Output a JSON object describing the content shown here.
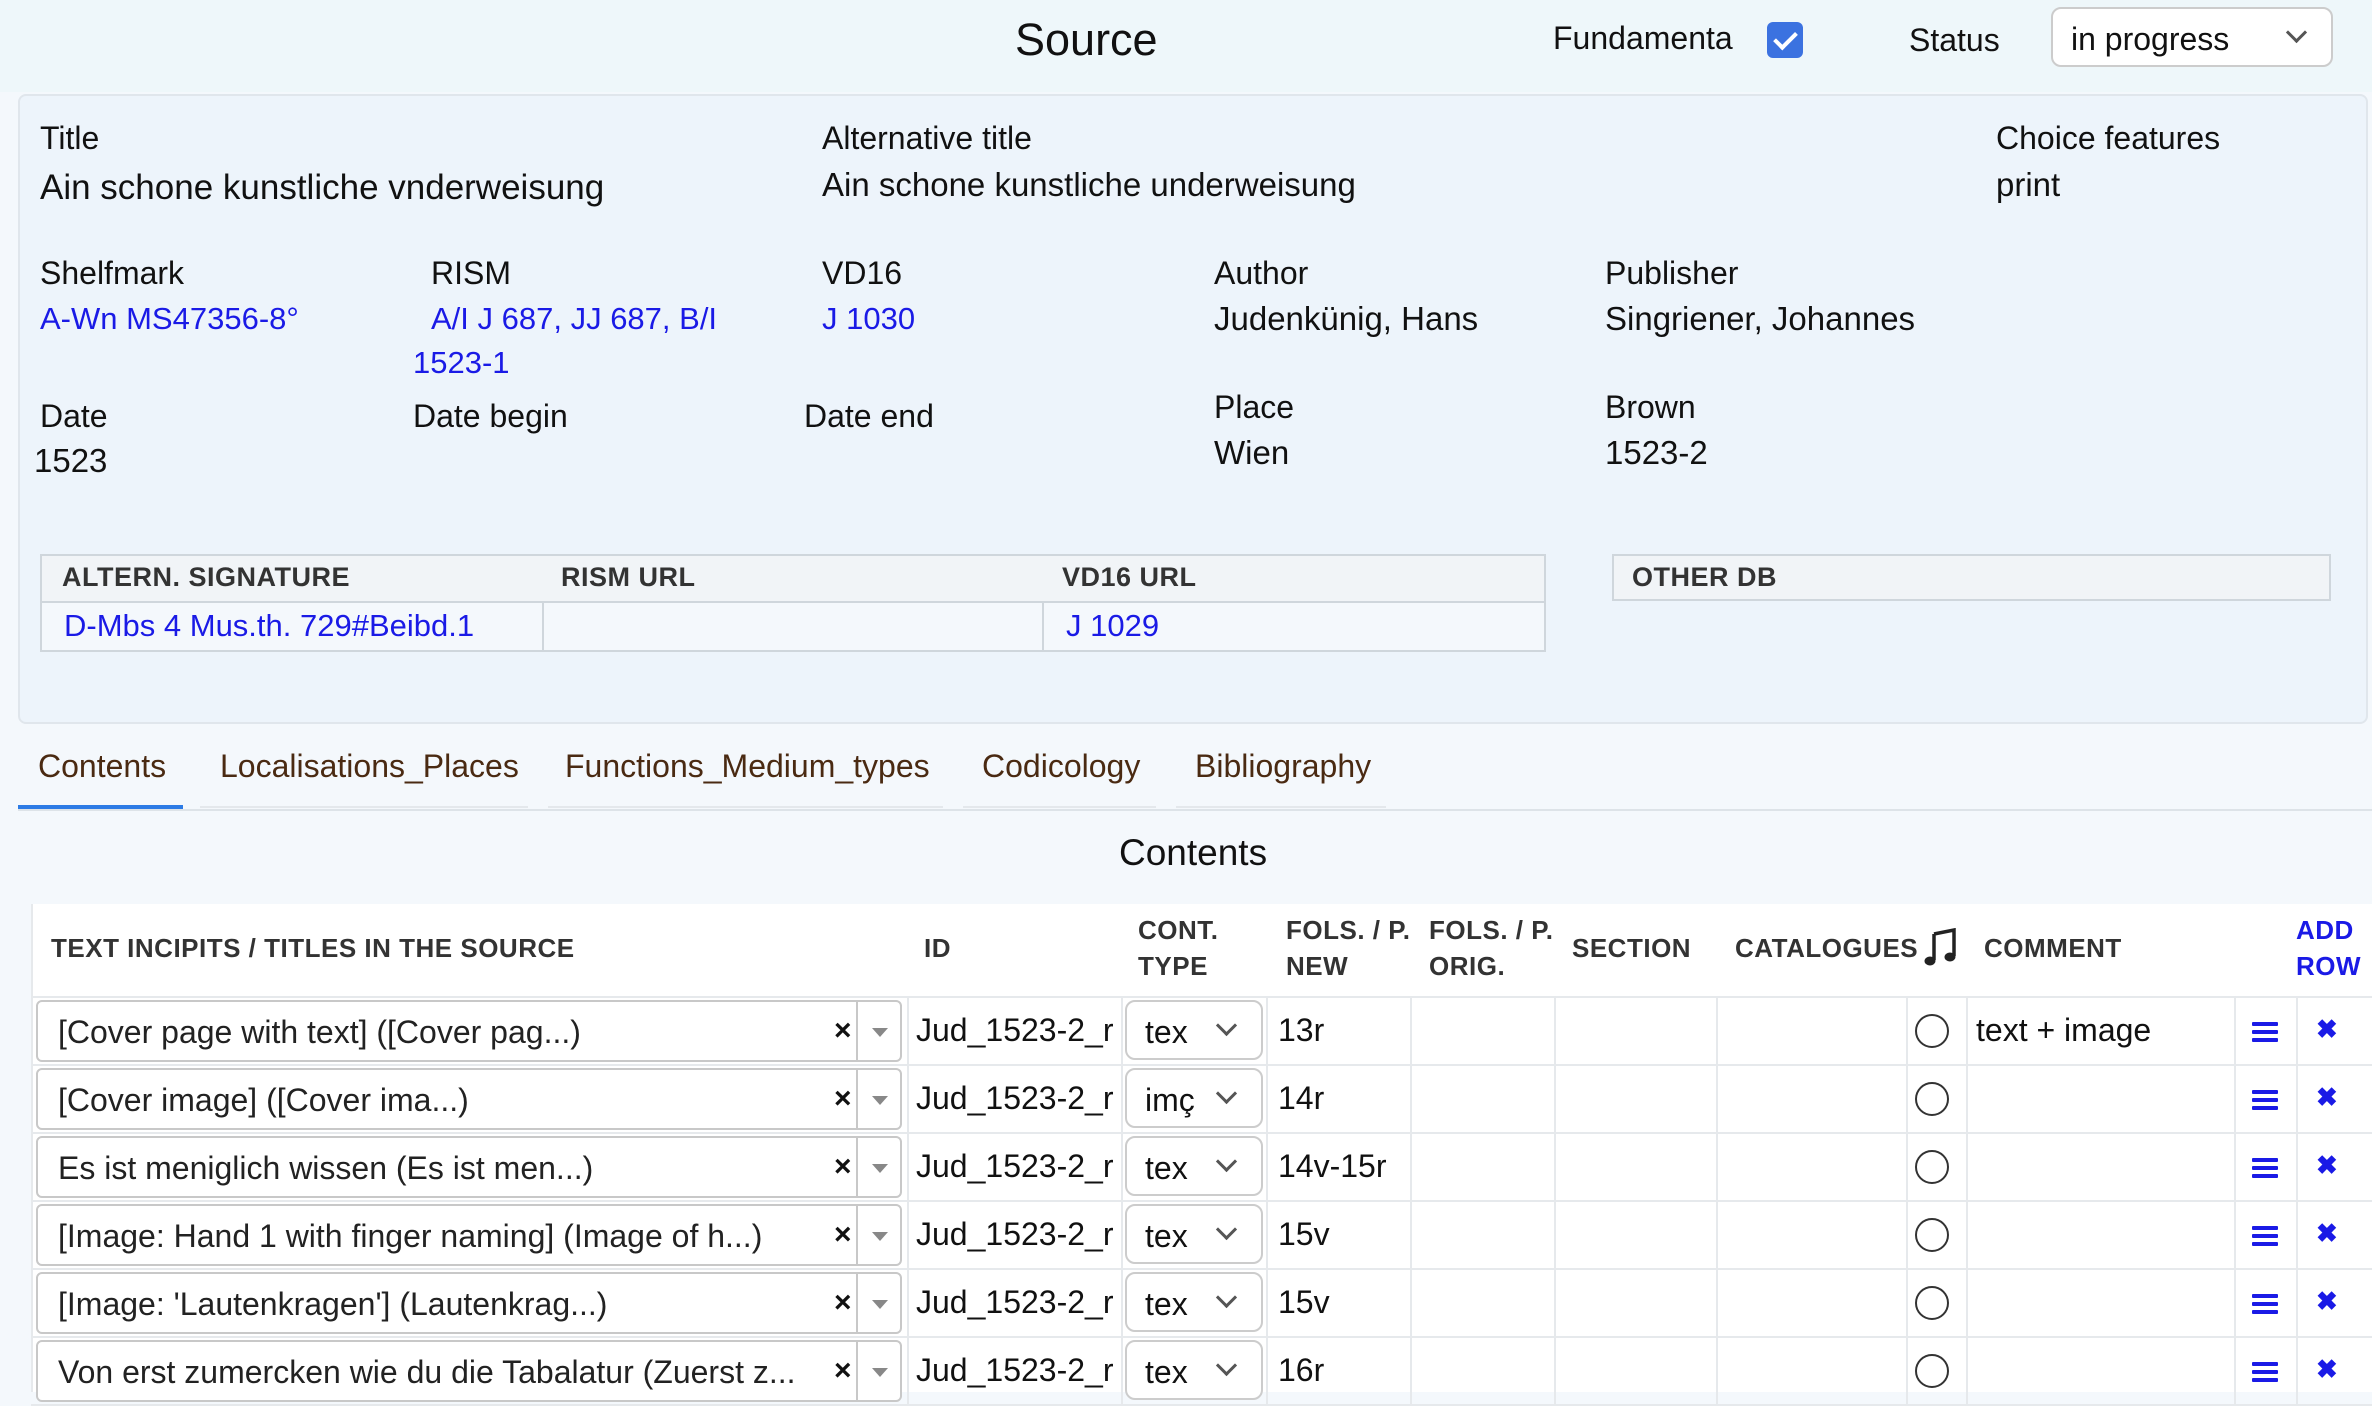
{
  "header": {
    "title": "Source",
    "fundamenta_label": "Fundamenta",
    "fundamenta_checked": true,
    "status_label": "Status",
    "status_value": "in progress"
  },
  "info": {
    "title_label": "Title",
    "title_value": "Ain schone kunstliche vnderweisung",
    "alt_title_label": "Alternative title",
    "alt_title_value": "Ain schone kunstliche underweisung",
    "choice_label": "Choice features",
    "choice_value": "print",
    "shelfmark_label": "Shelfmark",
    "shelfmark_value": "A-Wn MS47356-8°",
    "rism_label": "RISM",
    "rism_value_1": "A/I J 687, JJ 687, B/I",
    "rism_value_2": "1523-1",
    "vd16_label": "VD16",
    "vd16_value": "J 1030",
    "author_label": "Author",
    "author_value": "Judenkünig, Hans",
    "publisher_label": "Publisher",
    "publisher_value": "Singriener, Johannes",
    "date_label": "Date",
    "date_value": "1523",
    "date_begin_label": "Date begin",
    "date_end_label": "Date end",
    "place_label": "Place",
    "place_value": "Wien",
    "brown_label": "Brown",
    "brown_value": "1523-2"
  },
  "altern_table": {
    "headers": [
      "ALTERN. SIGNATURE",
      "RISM URL",
      "VD16 URL"
    ],
    "row": [
      "D-Mbs 4 Mus.th. 729#Beibd.1",
      "",
      "J 1029"
    ]
  },
  "other_db": {
    "header": "OTHER DB"
  },
  "tabs": [
    "Contents",
    "Localisations_Places",
    "Functions_Medium_types",
    "Codicology",
    "Bibliography"
  ],
  "contents": {
    "title": "Contents",
    "headers": {
      "incipit": "TEXT INCIPITS / TITLES IN THE SOURCE",
      "id": "ID",
      "cont_type_1": "CONT.",
      "cont_type_2": "TYPE",
      "fols_new_1": "FOLS. / P.",
      "fols_new_2": "NEW",
      "fols_orig_1": "FOLS. / P.",
      "fols_orig_2": "ORIG.",
      "section": "SECTION",
      "catalogues": "CATALOGUES",
      "music_icon": "music-note-icon",
      "comment": "COMMENT",
      "add_row_1": "ADD",
      "add_row_2": "ROW"
    },
    "rows": [
      {
        "incipit": "[Cover page with text] ([Cover pag...)",
        "id": "Jud_1523-2_r",
        "type": "tex",
        "fols": "13r",
        "comment": "text + image"
      },
      {
        "incipit": "[Cover image] ([Cover ima...)",
        "id": "Jud_1523-2_r",
        "type": "imç",
        "fols": "14r",
        "comment": ""
      },
      {
        "incipit": "Es ist meniglich wissen (Es ist men...)",
        "id": "Jud_1523-2_r",
        "type": "tex",
        "fols": "14v-15r",
        "comment": ""
      },
      {
        "incipit": "[Image: Hand 1 with finger naming] (Image of h...)",
        "id": "Jud_1523-2_r",
        "type": "tex",
        "fols": "15v",
        "comment": ""
      },
      {
        "incipit": "[Image: 'Lautenkragen'] (Lautenkrag...)",
        "id": "Jud_1523-2_r",
        "type": "tex",
        "fols": "15v",
        "comment": ""
      },
      {
        "incipit": "Von erst zumercken wie du die Tabalatur (Zuerst z...",
        "id": "Jud_1523-2_r",
        "type": "tex",
        "fols": "16r",
        "comment": ""
      }
    ]
  },
  "colors": {
    "link": "#1a1ae6",
    "checkbox": "#3b72e0",
    "tab_active": "#2c7be5"
  }
}
